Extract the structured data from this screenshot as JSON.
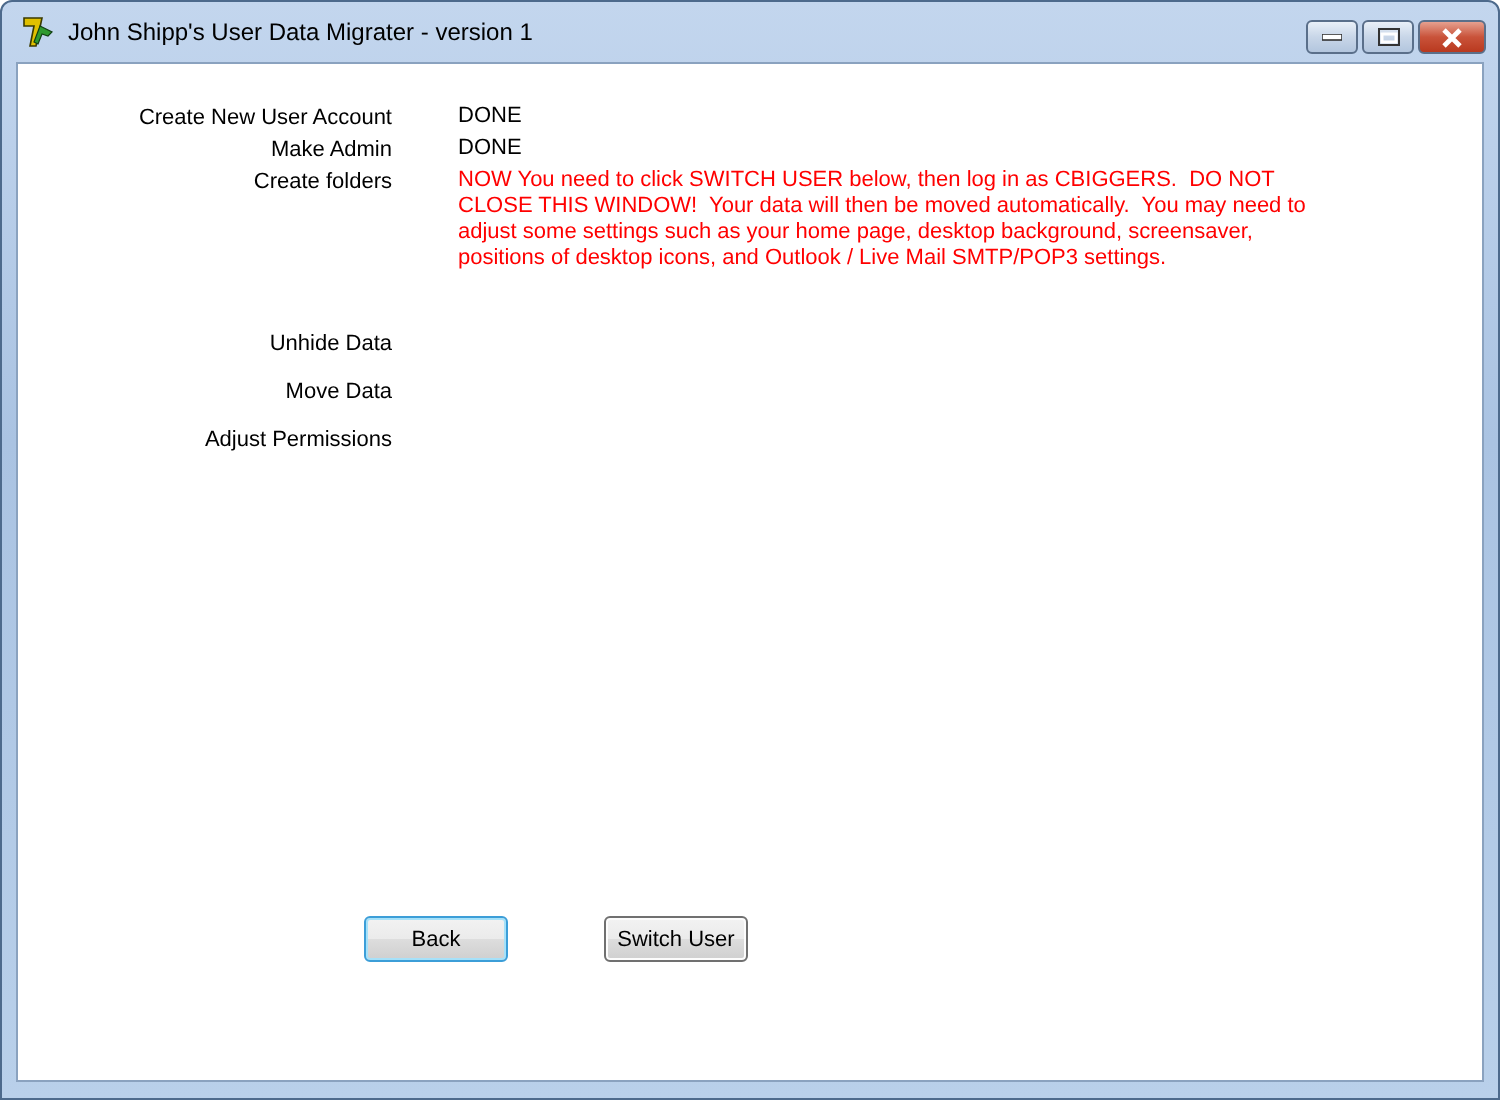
{
  "window": {
    "title": "John Shipp's User Data Migrater - version 1"
  },
  "steps": [
    {
      "label": "Create New User Account",
      "kind": "status",
      "value": "DONE"
    },
    {
      "label": "Make Admin",
      "kind": "status",
      "value": "DONE"
    },
    {
      "label": "Create folders",
      "kind": "message",
      "value": "NOW You need to click SWITCH USER below, then log in as CBIGGERS.  DO NOT CLOSE THIS WINDOW!  Your data will then be moved automatically.  You may need to adjust some settings such as your home page, desktop background, screensaver, positions of desktop icons, and Outlook / Live Mail SMTP/POP3 settings."
    },
    {
      "label": "Unhide Data"
    },
    {
      "label": "Move Data"
    },
    {
      "label": "Adjust Permissions"
    }
  ],
  "buttons": [
    {
      "label": "Back",
      "focused": true
    },
    {
      "label": "Switch User",
      "focused": false
    }
  ]
}
